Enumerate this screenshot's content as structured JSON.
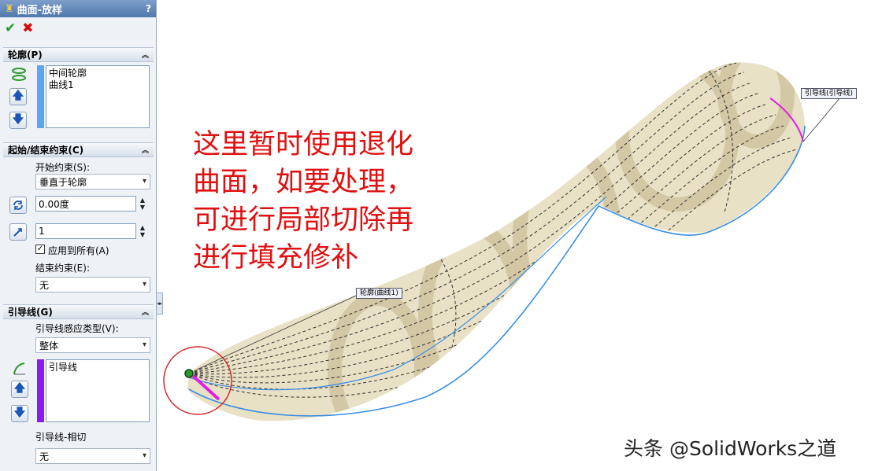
{
  "panel": {
    "title": "曲面-放样",
    "help": "?",
    "ok_symbol": "✔",
    "cancel_symbol": "✖",
    "profiles": {
      "header": "轮廓(P)",
      "items": [
        "中间轮廓",
        "曲线1"
      ],
      "color": "#5aa7f0"
    },
    "constraints": {
      "header": "起始/结束约束(C)",
      "start_label": "开始约束(S):",
      "start_value": "垂直于轮廓",
      "angle_value": "0.00度",
      "length_value": "1",
      "apply_all_label": "应用到所有(A)",
      "apply_all_checked": true,
      "end_label": "结束约束(E):",
      "end_value": "无"
    },
    "guides": {
      "header": "引导线(G)",
      "influence_label": "引导线感应类型(V):",
      "influence_value": "整体",
      "items": [
        "引导线"
      ],
      "color": "#8a1cf0",
      "tangency_label": "引导线-相切",
      "tangency_value": "无"
    }
  },
  "viewport": {
    "note_lines": [
      "这里暂时使用退化",
      "曲面，如要处理，",
      "可进行局部切除再",
      "进行填充修补"
    ],
    "callout_profile": "轮廓(曲线1)",
    "callout_guide": "引导线(引导线)",
    "watermark": "头条 @SolidWorks之道",
    "surface_color": "#e9e1c6",
    "edge_color": "#3a8ee6",
    "guide_color": "#e020e0",
    "highlight_color": "#d42020"
  }
}
